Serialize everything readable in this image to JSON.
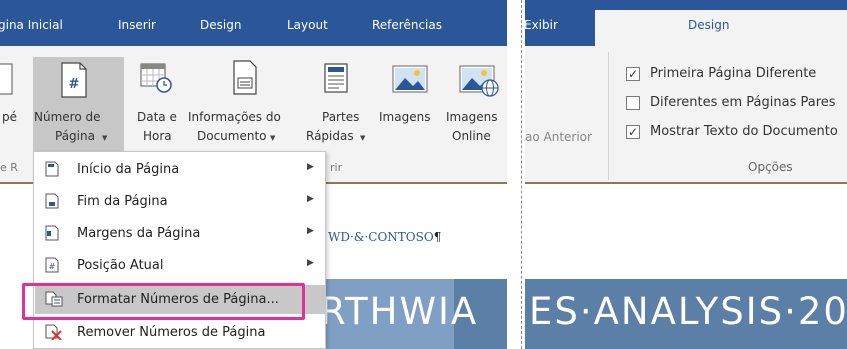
{
  "left_panel": {
    "tabs": [
      "gina Inicial",
      "Inserir",
      "Design",
      "Layout",
      "Referências"
    ],
    "ribbon": {
      "partial_pe": "pé",
      "page_number_btn": {
        "line1": "Número de",
        "line2": "Página"
      },
      "datetime_btn": {
        "line1": "Data e",
        "line2": "Hora"
      },
      "docinfo_btn": {
        "line1": "Informações do",
        "line2": "Documento"
      },
      "quickparts_btn": {
        "line1": "Partes",
        "line2": "Rápidas"
      },
      "images_btn": {
        "line1": "Imagens"
      },
      "online_images_btn": {
        "line1": "Imagens",
        "line2": "Online"
      },
      "group_cut_left": "e R",
      "group_cut_right": "rir"
    },
    "menu": {
      "items": [
        {
          "label": "Início da Página",
          "submenu": true
        },
        {
          "label": "Fim da Página",
          "submenu": true
        },
        {
          "label": "Margens da Página",
          "submenu": true
        },
        {
          "label": "Posição Atual",
          "submenu": true
        },
        {
          "label": "Formatar Números de Página...",
          "submenu": false,
          "highlighted": true
        },
        {
          "label": "Remover Números de Página",
          "submenu": false
        }
      ]
    },
    "document": {
      "header_text": "WD·&·CONTOSO",
      "pilcrow": "¶",
      "heading_part1": "RTHWIA",
      "heading_part2": "ES·ANALYSIS·20"
    }
  },
  "right_panel": {
    "tab_exibir": "Exibir",
    "tab_design": "Design",
    "prev_section_label": "ao Anterior",
    "options": [
      {
        "label": "Primeira Página Diferente",
        "checked": true
      },
      {
        "label": "Diferentes em Páginas Pares",
        "checked": false
      },
      {
        "label": "Mostrar Texto do Documento",
        "checked": true
      }
    ],
    "group_label": "Opções"
  },
  "colors": {
    "word_blue": "#2b579a",
    "highlight_pink": "#e0309a",
    "ribbon_bg": "#f3f3f3",
    "heading_band": "#5b7fa6"
  }
}
